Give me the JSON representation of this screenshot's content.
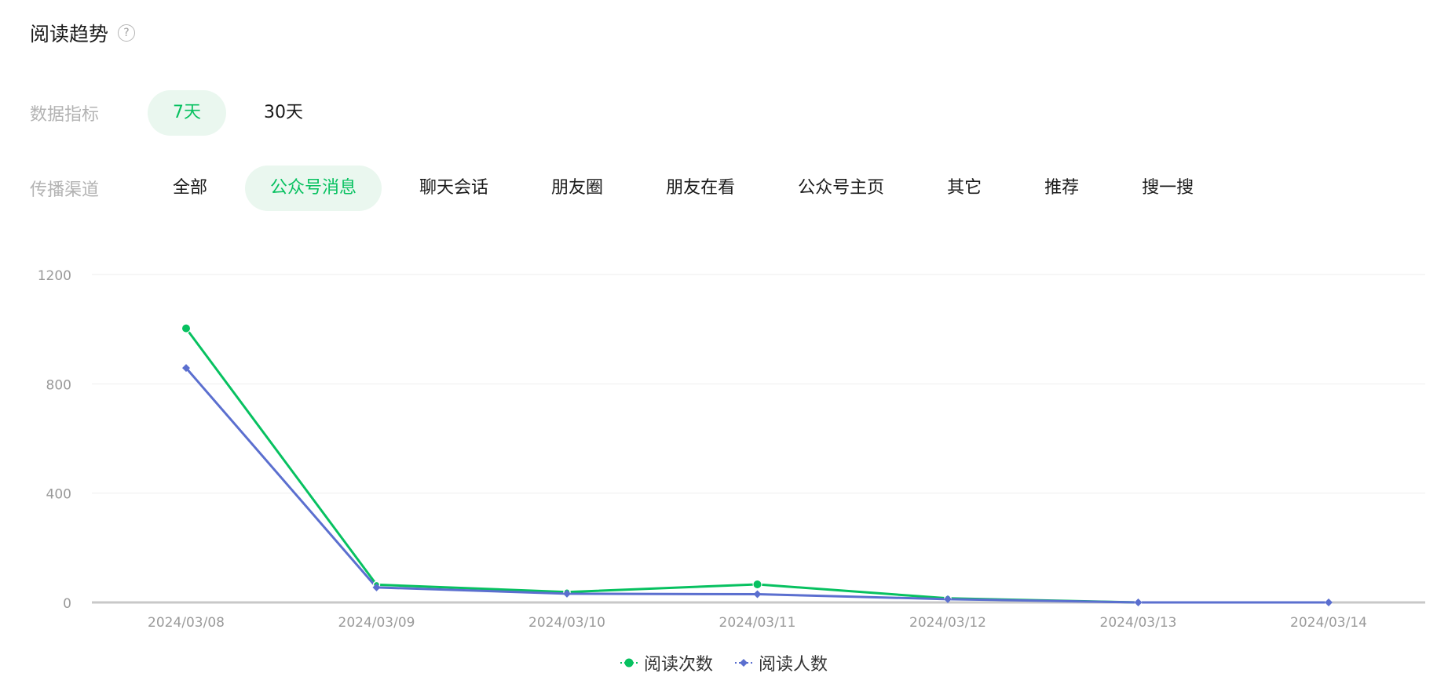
{
  "header": {
    "title": "阅读趋势",
    "help_symbol": "?"
  },
  "metric_row": {
    "label": "数据指标",
    "options": [
      "7天",
      "30天"
    ],
    "selected": "7天"
  },
  "channel_row": {
    "label": "传播渠道",
    "options": [
      "全部",
      "公众号消息",
      "聊天会话",
      "朋友圈",
      "朋友在看",
      "公众号主页",
      "其它",
      "推荐",
      "搜一搜"
    ],
    "selected": "公众号消息"
  },
  "colors": {
    "accent": "#07c160",
    "series_reads": "#07c160",
    "series_readers": "#5b6fcf",
    "grid": "#eeeeee",
    "axis": "#c8c8c8"
  },
  "chart_data": {
    "type": "line",
    "x": [
      "2024/03/08",
      "2024/03/09",
      "2024/03/10",
      "2024/03/11",
      "2024/03/12",
      "2024/03/13",
      "2024/03/14"
    ],
    "ylim": [
      0,
      1200
    ],
    "yticks": [
      0,
      400,
      800,
      1200
    ],
    "grid": true,
    "legend_position": "bottom-center",
    "series": [
      {
        "name": "阅读次数",
        "values": [
          1003,
          65,
          38,
          66,
          15,
          0,
          0
        ],
        "marker": "circle",
        "color": "#07c160"
      },
      {
        "name": "阅读人数",
        "values": [
          858,
          55,
          32,
          30,
          12,
          0,
          0
        ],
        "marker": "diamond",
        "color": "#5b6fcf"
      }
    ]
  }
}
